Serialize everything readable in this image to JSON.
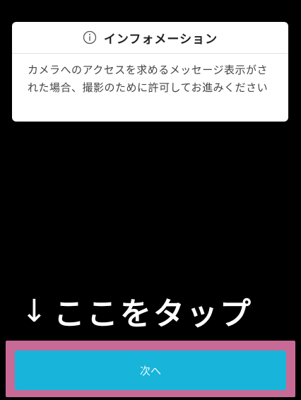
{
  "info_card": {
    "icon": "info-circle-icon",
    "title": "インフォメーション",
    "message": "カメラへのアクセスを求めるメッセージ表示がされた場合、撮影のために許可してお進みください"
  },
  "annotation": {
    "arrow_icon": "down-arrow-icon",
    "arrow_glyph": "↓",
    "text": "ここをタップ"
  },
  "button": {
    "label": "次へ"
  },
  "colors": {
    "background": "#000000",
    "card": "#ffffff",
    "button": "#18b4da",
    "highlight": "#c86a96"
  }
}
